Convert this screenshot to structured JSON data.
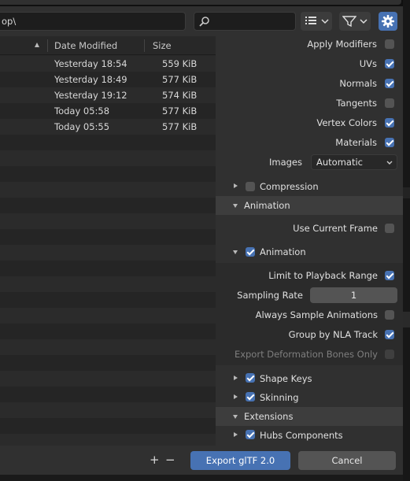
{
  "header": {
    "path": "op\\",
    "search_value": "",
    "view_icon": "thumbnails-view-icon",
    "filter_icon": "filter-funnel-icon",
    "settings_icon": "gear-icon"
  },
  "file_list": {
    "columns": {
      "name": "",
      "date": "Date Modified",
      "size": "Size"
    },
    "rows": [
      {
        "date": "Yesterday 18:54",
        "size": "559 KiB"
      },
      {
        "date": "Yesterday 18:49",
        "size": "577 KiB"
      },
      {
        "date": "Yesterday 19:12",
        "size": "574 KiB"
      },
      {
        "date": "Today 05:58",
        "size": "577 KiB"
      },
      {
        "date": "Today 05:55",
        "size": "577 KiB"
      }
    ]
  },
  "options": {
    "apply_modifiers": {
      "label": "Apply Modifiers",
      "checked": false
    },
    "uvs": {
      "label": "UVs",
      "checked": true
    },
    "normals": {
      "label": "Normals",
      "checked": true
    },
    "tangents": {
      "label": "Tangents",
      "checked": false
    },
    "vertex_colors": {
      "label": "Vertex Colors",
      "checked": true
    },
    "materials": {
      "label": "Materials",
      "checked": true
    },
    "images": {
      "label": "Images",
      "value": "Automatic"
    },
    "compression": {
      "label": "Compression",
      "checked": false
    },
    "animation_section": {
      "label": "Animation"
    },
    "use_current_frame": {
      "label": "Use Current Frame",
      "checked": false
    },
    "animation": {
      "label": "Animation",
      "checked": true
    },
    "limit_playback": {
      "label": "Limit to Playback Range",
      "checked": true
    },
    "sampling_rate": {
      "label": "Sampling Rate",
      "value": "1"
    },
    "always_sample": {
      "label": "Always Sample Animations",
      "checked": false
    },
    "group_nla": {
      "label": "Group by NLA Track",
      "checked": true
    },
    "export_deform": {
      "label": "Export Deformation Bones Only",
      "checked": false,
      "disabled": true
    },
    "shape_keys": {
      "label": "Shape Keys",
      "checked": true
    },
    "skinning": {
      "label": "Skinning",
      "checked": true
    },
    "extensions_section": {
      "label": "Extensions"
    },
    "hubs_components": {
      "label": "Hubs Components",
      "checked": true
    }
  },
  "footer": {
    "plus_label": "+",
    "minus_label": "−",
    "export_label": "Export glTF 2.0",
    "cancel_label": "Cancel"
  },
  "colors": {
    "accent": "#4772b3",
    "panel": "#303030",
    "list_bg": "#282828"
  }
}
